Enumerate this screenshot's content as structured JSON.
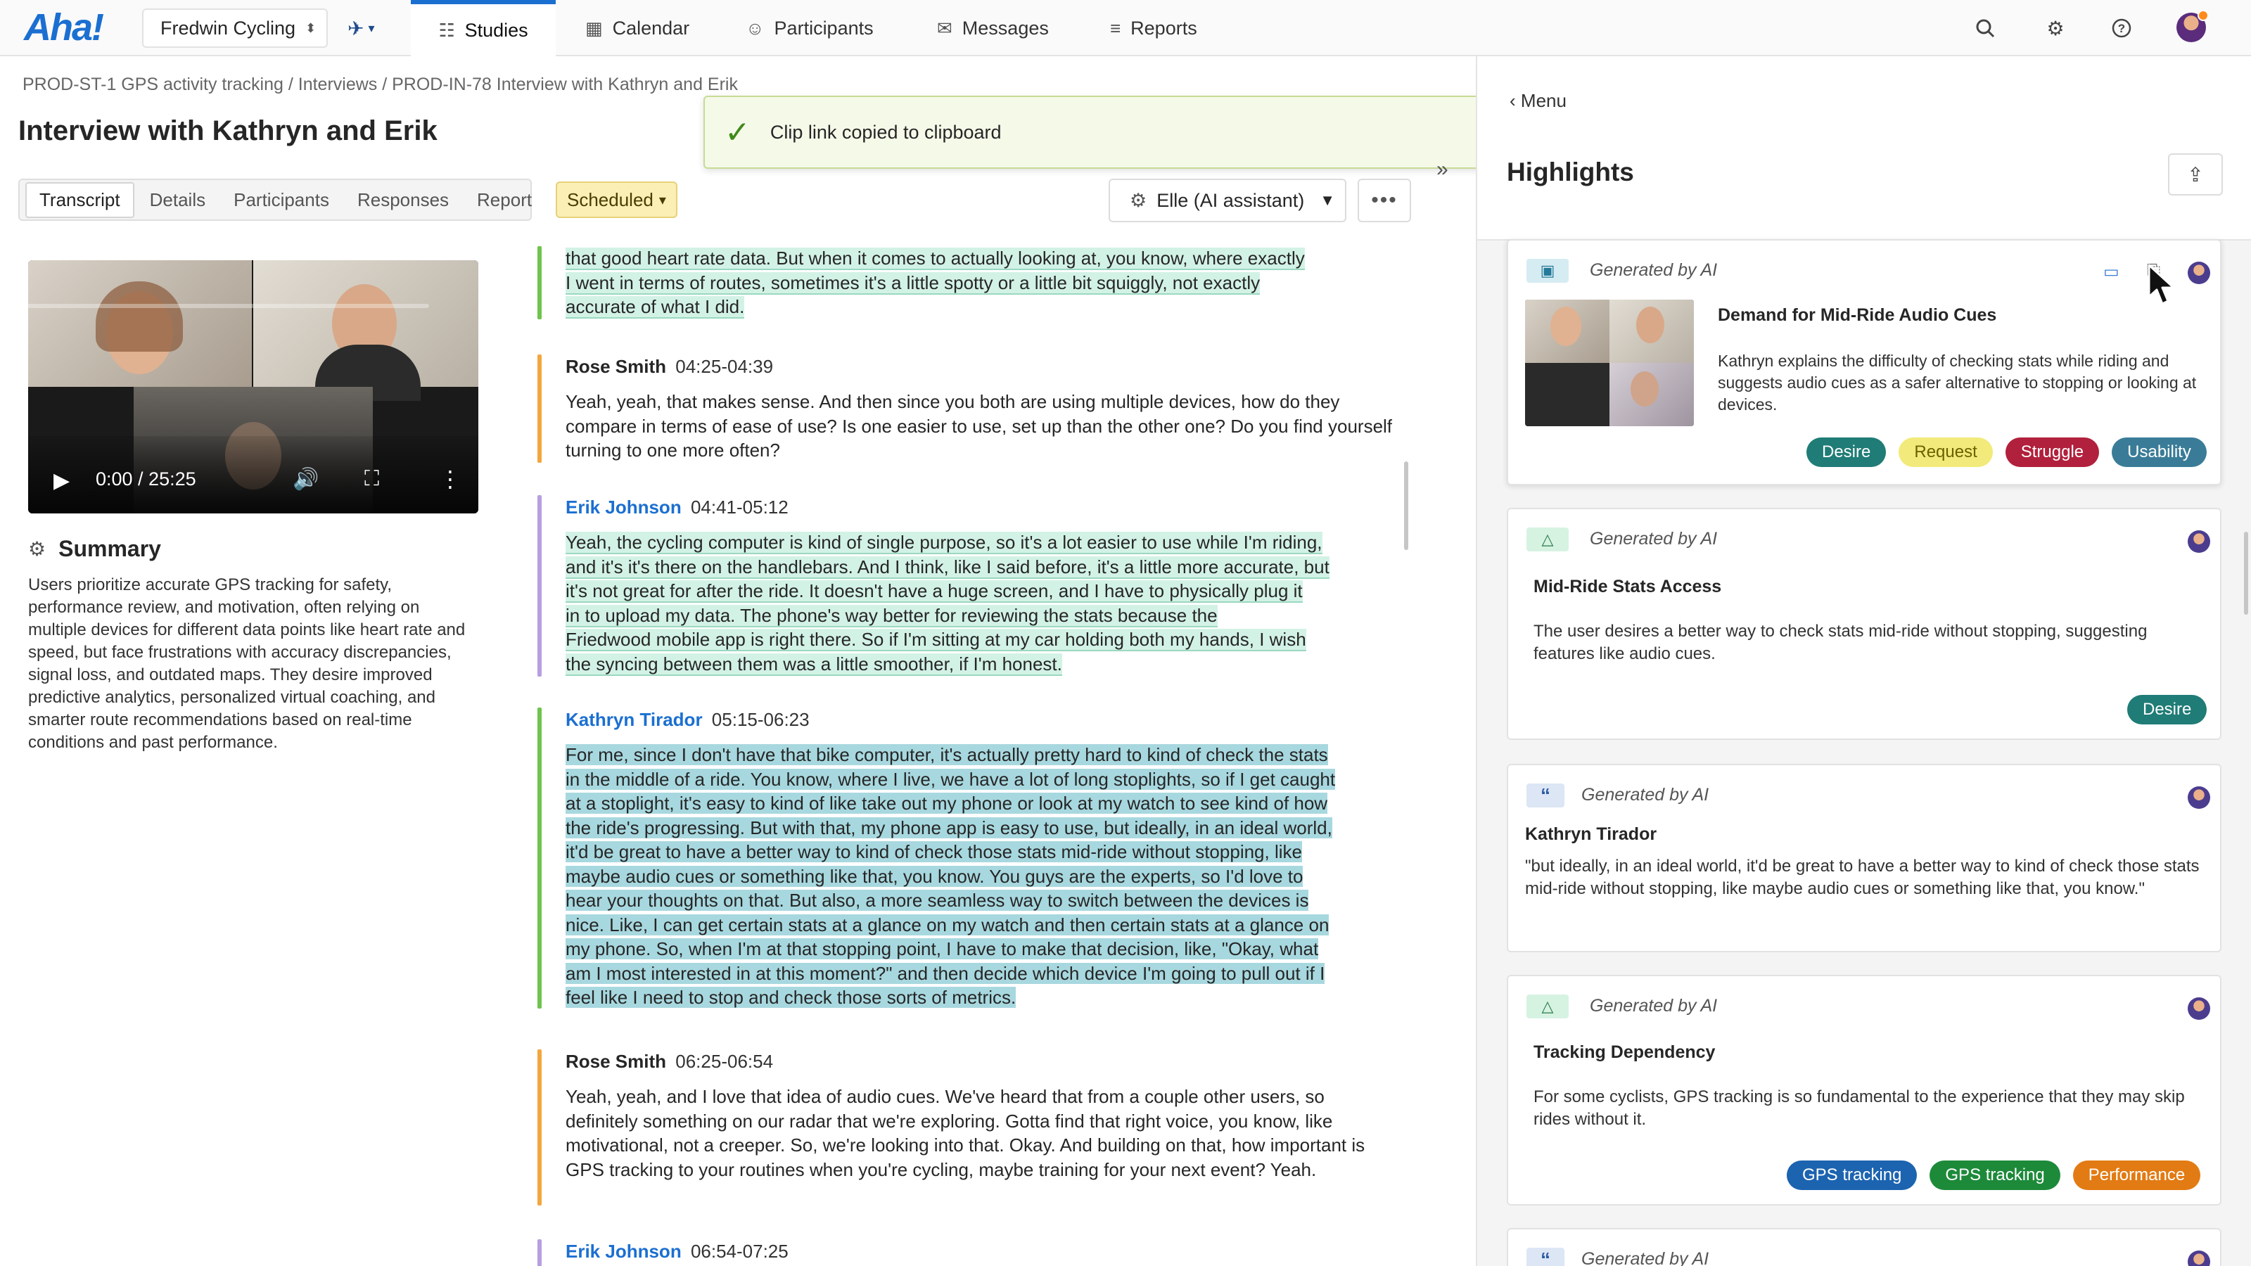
{
  "app": {
    "logo": "Aha!",
    "workspace": "Fredwin Cycling"
  },
  "nav": {
    "tabs": [
      {
        "label": "Studies",
        "icon": "studies-icon"
      },
      {
        "label": "Calendar",
        "icon": "calendar-icon"
      },
      {
        "label": "Participants",
        "icon": "participants-icon"
      },
      {
        "label": "Messages",
        "icon": "messages-icon"
      },
      {
        "label": "Reports",
        "icon": "reports-icon"
      }
    ],
    "active": "Studies"
  },
  "breadcrumb": "PROD-ST-1 GPS activity tracking / Interviews / PROD-IN-78 Interview with Kathryn and Erik",
  "page_title": "Interview with Kathryn and Erik",
  "subtabs": [
    "Transcript",
    "Details",
    "Participants",
    "Responses",
    "Report"
  ],
  "status": "Scheduled",
  "assistant": "Elle (AI assistant)",
  "toast": {
    "message": "Clip link copied to clipboard"
  },
  "video": {
    "time": "0:00 / 25:25"
  },
  "summary": {
    "title": "Summary",
    "text": "Users prioritize accurate GPS tracking for safety, performance review, and motivation, often relying on multiple devices for different data points like heart rate and speed, but face frustrations with accuracy discrepancies, signal loss, and outdated maps. They desire improved predictive analytics, personalized virtual coaching, and smarter route recommendations based on real-time conditions and past performance."
  },
  "transcript": {
    "e0": {
      "lines": [
        "that good heart rate data. But when it comes to actually looking at, you know, where exactly",
        "I went in terms of routes, sometimes it's a little spotty or a little bit squiggly, not exactly",
        "accurate of what I did."
      ]
    },
    "e1": {
      "speaker": "Rose Smith",
      "time": "04:25-04:39",
      "text": "Yeah, yeah, that makes sense. And then since you both are using multiple devices, how do they compare in terms of ease of use? Is one easier to use, set up than the other one? Do you find yourself turning to one more often?"
    },
    "e2": {
      "speaker": "Erik Johnson",
      "time": "04:41-05:12",
      "lines": [
        "Yeah, the cycling computer is kind of single purpose, so it's a lot easier to use while I'm riding,",
        "and it's it's there on the handlebars. And I think, like I said before, it's a little more accurate, but",
        "it's not great for after the ride. It doesn't have a huge screen, and I have to physically plug it",
        "in to upload my data. The phone's way better for reviewing the stats because the",
        "Friedwood mobile app is right there. So if I'm sitting at my car holding both my hands, I wish",
        "the syncing between them was a little smoother, if I'm honest."
      ]
    },
    "e3": {
      "speaker": "Kathryn Tirador",
      "time": "05:15-06:23",
      "lines": [
        "For me, since I don't have that bike computer, it's actually pretty hard to kind of check the stats",
        "in the middle of a ride. You know, where I live, we have a lot of long stoplights, so if I get caught",
        "at a stoplight, it's easy to kind of like take out my phone or look at my watch to see kind of how",
        "the ride's progressing. But with that, my phone app is easy to use, but ideally, in an ideal world,",
        "it'd be great to have a better way to kind of check those stats mid-ride without stopping, like",
        "maybe audio cues or something like that, you know. You guys are the experts, so I'd love to",
        "hear your thoughts on that. But also, a more seamless way to switch between the devices is",
        "nice. Like, I can get certain stats at a glance on my watch and then certain stats at a glance on",
        "my phone. So, when I'm at that stopping point, I have to make that decision, like, \"Okay, what",
        "am I most interested in at this moment?\" and then decide which device I'm going to pull out if I",
        "feel like I need to stop and check those sorts of metrics."
      ]
    },
    "e4": {
      "speaker": "Rose Smith",
      "time": "06:25-06:54",
      "text": "Yeah, yeah, and I love that idea of audio cues. We've heard that from a couple other users, so definitely something on our radar that we're exploring. Gotta find that right voice, you know, like motivational, not a creeper. So, we're looking into that. Okay. And building on that, how important is GPS tracking to your routines when you're cycling, maybe training for your next event? Yeah."
    },
    "e5": {
      "speaker": "Erik Johnson",
      "time": "06:54-07:25"
    }
  },
  "highlights": {
    "menu_label": "Menu",
    "title": "Highlights",
    "cards": [
      {
        "generated": "Generated by AI",
        "title": "Demand for Mid-Ride Audio Cues",
        "text": "Kathryn explains the difficulty of checking stats while riding and suggests audio cues as a safer alternative to stopping or looking at devices.",
        "tags": [
          "Desire",
          "Request",
          "Struggle",
          "Usability"
        ]
      },
      {
        "generated": "Generated by AI",
        "title": "Mid-Ride Stats Access",
        "text": "The user desires a better way to check stats mid-ride without stopping, suggesting features like audio cues.",
        "tags": [
          "Desire"
        ]
      },
      {
        "generated": "Generated by AI",
        "title": "Kathryn Tirador",
        "text": "\"but ideally, in an ideal world, it'd be great to have a better way to kind of check those stats mid-ride without stopping, like maybe audio cues or something like that, you know.\""
      },
      {
        "generated": "Generated by AI",
        "title": "Tracking Dependency",
        "text": "For some cyclists, GPS tracking is so fundamental to the experience that they may skip rides without it.",
        "tags": [
          "GPS tracking",
          "GPS tracking",
          "Performance"
        ]
      },
      {
        "generated": "Generated by AI"
      }
    ]
  },
  "colors": {
    "accent": "#1b6fd1",
    "status_scheduled": "#fbefb5",
    "highlight_green": "#d3f2e6",
    "highlight_teal": "#a8d8df"
  }
}
